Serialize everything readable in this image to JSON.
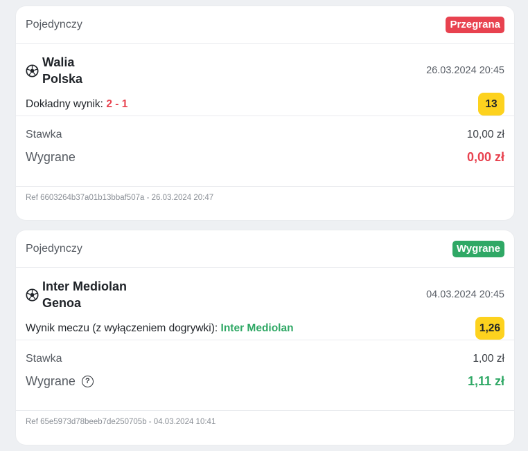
{
  "colors": {
    "lost": "#e8424f",
    "won": "#2fa865",
    "odds_bg": "#fdd21e"
  },
  "bets": [
    {
      "type": "Pojedynczy",
      "status": "Przegrana",
      "home": "Walia",
      "away": "Polska",
      "sport_icon": "soccer-ball-icon",
      "date": "26.03.2024 20:45",
      "market": "Dokładny wynik:",
      "selection": "2 - 1",
      "odds": "13",
      "stake_label": "Stawka",
      "stake": "10,00 zł",
      "win_label": "Wygrane",
      "win": "0,00 zł",
      "ref": "Ref 6603264b37a01b13bbaf507a - 26.03.2024 20:47"
    },
    {
      "type": "Pojedynczy",
      "status": "Wygrane",
      "home": "Inter Mediolan",
      "away": "Genoa",
      "sport_icon": "soccer-ball-icon",
      "date": "04.03.2024 20:45",
      "market": "Wynik meczu (z wyłączeniem dogrywki):",
      "selection": "Inter Mediolan",
      "odds": "1,26",
      "stake_label": "Stawka",
      "stake": "1,00 zł",
      "win_label": "Wygrane",
      "win": "1,11 zł",
      "help_icon": "question-circle-icon",
      "ref": "Ref 65e5973d78beeb7de250705b - 04.03.2024 10:41"
    }
  ]
}
